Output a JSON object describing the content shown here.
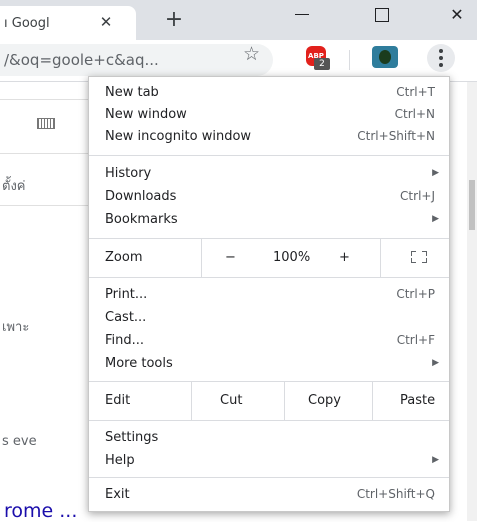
{
  "tab": {
    "title": "ı Googl",
    "close": "✕",
    "new_tab": "+"
  },
  "window": {
    "close": "✕"
  },
  "address_bar": {
    "url_text": "/&oq=goole+c&aq..."
  },
  "extensions": {
    "abp_label": "ABP",
    "abp_badge": "2"
  },
  "background": {
    "frag_1": "ตั้งค่",
    "frag_2": "เพาะ",
    "frag_3": "s eve",
    "frag_bottom": "rome ..."
  },
  "menu": {
    "new_tab": {
      "label": "New tab",
      "shortcut": "Ctrl+T"
    },
    "new_window": {
      "label": "New window",
      "shortcut": "Ctrl+N"
    },
    "new_incognito": {
      "label": "New incognito window",
      "shortcut": "Ctrl+Shift+N"
    },
    "history": {
      "label": "History"
    },
    "downloads": {
      "label": "Downloads",
      "shortcut": "Ctrl+J"
    },
    "bookmarks": {
      "label": "Bookmarks"
    },
    "zoom": {
      "label": "Zoom",
      "minus": "−",
      "level": "100%",
      "plus": "+"
    },
    "print": {
      "label": "Print...",
      "shortcut": "Ctrl+P"
    },
    "cast": {
      "label": "Cast..."
    },
    "find": {
      "label": "Find...",
      "shortcut": "Ctrl+F"
    },
    "more_tools": {
      "label": "More tools"
    },
    "edit": {
      "label": "Edit",
      "cut": "Cut",
      "copy": "Copy",
      "paste": "Paste"
    },
    "settings": {
      "label": "Settings"
    },
    "help": {
      "label": "Help"
    },
    "exit": {
      "label": "Exit",
      "shortcut": "Ctrl+Shift+Q"
    },
    "submenu_arrow": "▶"
  }
}
